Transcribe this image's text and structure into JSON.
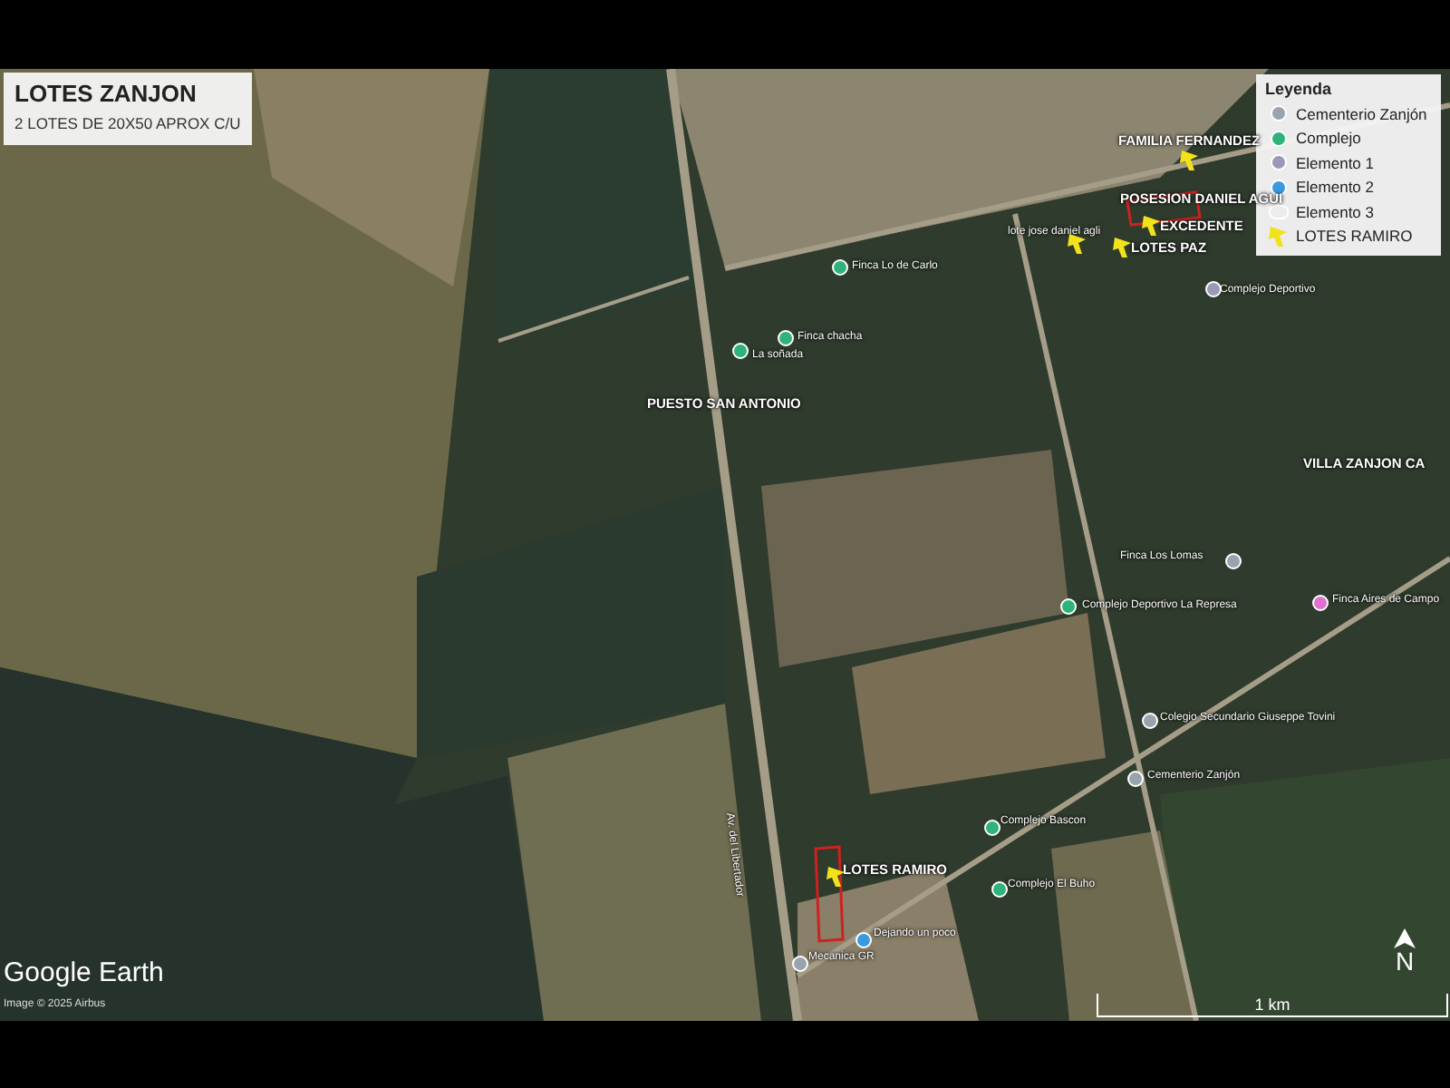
{
  "title_card": {
    "title": "LOTES ZANJON",
    "subtitle": "2 LOTES DE 20X50 APROX C/U"
  },
  "legend": {
    "title": "Leyenda",
    "items": [
      {
        "label": "Cementerio Zanjón",
        "kind": "dot",
        "color": "#9aa3ad"
      },
      {
        "label": "Complejo",
        "kind": "dot",
        "color": "#2fb37a"
      },
      {
        "label": "Elemento 1",
        "kind": "dot",
        "color": "#9a9ab8"
      },
      {
        "label": "Elemento 2",
        "kind": "dot",
        "color": "#3a9ae0"
      },
      {
        "label": "Elemento 3",
        "kind": "polygon",
        "color": "#ffffff"
      },
      {
        "label": "LOTES RAMIRO",
        "kind": "pin",
        "color": "#f2e21a"
      }
    ]
  },
  "placemarks": [
    {
      "label": "FAMILIA FERNANDEZ",
      "kind": "pin",
      "color": "#f2e21a"
    },
    {
      "label": "POSESION DANIEL AGUI",
      "kind": "title"
    },
    {
      "label": "EXCEDENTE",
      "kind": "pin",
      "color": "#f2e21a"
    },
    {
      "label": "lote jose daniel agli",
      "kind": "pin",
      "color": "#f2e21a"
    },
    {
      "label": "LOTES PAZ",
      "kind": "pin",
      "color": "#f2e21a"
    },
    {
      "label": "Finca Lo de Carlo",
      "kind": "dot",
      "color": "#2fb37a"
    },
    {
      "label": "Finca chacha",
      "kind": "dot",
      "color": "#2fb37a"
    },
    {
      "label": "La soñada",
      "kind": "dot",
      "color": "#2fb37a"
    },
    {
      "label": "Complejo Deportivo",
      "kind": "dot",
      "color": "#9a9ab8"
    },
    {
      "label": "PUESTO SAN ANTONIO",
      "kind": "title"
    },
    {
      "label": "VILLA ZANJON CA",
      "kind": "title"
    },
    {
      "label": "Finca Los Lomas",
      "kind": "dot",
      "color": "#9aa3ad"
    },
    {
      "label": "Complejo Deportivo La Represa",
      "kind": "dot",
      "color": "#2fb37a"
    },
    {
      "label": "Finca Aires de Campo",
      "kind": "dot",
      "color": "#e070d0"
    },
    {
      "label": "Colegio Secundario Giuseppe Tovini",
      "kind": "dot",
      "color": "#9aa3ad"
    },
    {
      "label": "Cementerio Zanjón",
      "kind": "dot",
      "color": "#9aa3ad"
    },
    {
      "label": "Complejo Bascon",
      "kind": "dot",
      "color": "#2fb37a"
    },
    {
      "label": "LOTES RAMIRO",
      "kind": "pin",
      "color": "#f2e21a"
    },
    {
      "label": "Complejo El Buho",
      "kind": "dot",
      "color": "#2fb37a"
    },
    {
      "label": "Dejando un poco",
      "kind": "dot",
      "color": "#3a9ae0"
    },
    {
      "label": "Mecanica GR",
      "kind": "dot",
      "color": "#9aa3ad"
    },
    {
      "label": "Av. del Libertador",
      "kind": "road"
    }
  ],
  "attribution": {
    "logo": "Google Earth",
    "credit": "Image © 2025 Airbus"
  },
  "scale": {
    "label": "1 km"
  },
  "compass": {
    "label": "N"
  }
}
